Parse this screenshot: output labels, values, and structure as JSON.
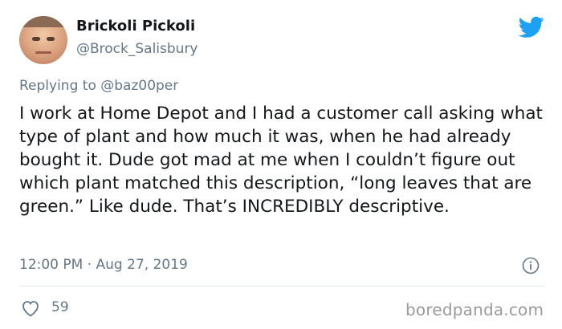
{
  "author": {
    "display_name": "Brickoli Pickoli",
    "handle": "@Brock_Salisbury"
  },
  "reply": {
    "prefix": "Replying to",
    "mention": "@baz00per"
  },
  "tweet": {
    "text": "I work at Home Depot and I had a customer call asking what type of plant and how much it was, when he had already bought it. Dude got mad at me when I couldn’t figure out which plant matched this description, “long leaves that are green.” Like dude. That’s INCREDIBLY descriptive.",
    "timestamp": "12:00 PM · Aug 27, 2019",
    "like_count": "59"
  },
  "watermark": "boredpanda.com",
  "colors": {
    "twitter_blue": "#1da1f2",
    "text_primary": "#14171a",
    "text_secondary": "#657786",
    "divider": "#e1e8ed",
    "watermark": "#9a9a9a"
  },
  "icons": {
    "brand": "twitter-bird-icon",
    "info": "info-icon",
    "like": "heart-icon"
  }
}
